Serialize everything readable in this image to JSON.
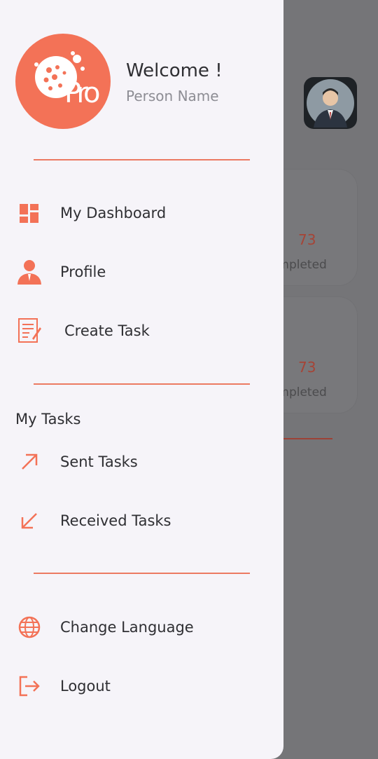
{
  "colors": {
    "accent": "#f37257",
    "drawer_bg": "#f6f4f9",
    "text": "#2f2f33",
    "muted": "#8d8d94"
  },
  "logo": {
    "text": "Pro"
  },
  "header": {
    "welcome": "Welcome !",
    "person_name": "Person Name"
  },
  "menu": {
    "dashboard": {
      "label": "My Dashboard",
      "icon": "dashboard-icon"
    },
    "profile": {
      "label": "Profile",
      "icon": "person-icon"
    },
    "create_task": {
      "label": "Create Task",
      "icon": "document-edit-icon"
    }
  },
  "tasks_section": {
    "title": "My Tasks",
    "sent": {
      "label": "Sent Tasks",
      "icon": "arrow-up-right-icon"
    },
    "received": {
      "label": "Received Tasks",
      "icon": "arrow-down-left-icon"
    }
  },
  "settings": {
    "language": {
      "label": "Change Language",
      "icon": "globe-icon"
    },
    "logout": {
      "label": "Logout",
      "icon": "logout-icon"
    }
  },
  "background": {
    "card1": {
      "value": "73",
      "label": "ompleted"
    },
    "card2": {
      "value": "73",
      "label": "ompleted"
    }
  }
}
